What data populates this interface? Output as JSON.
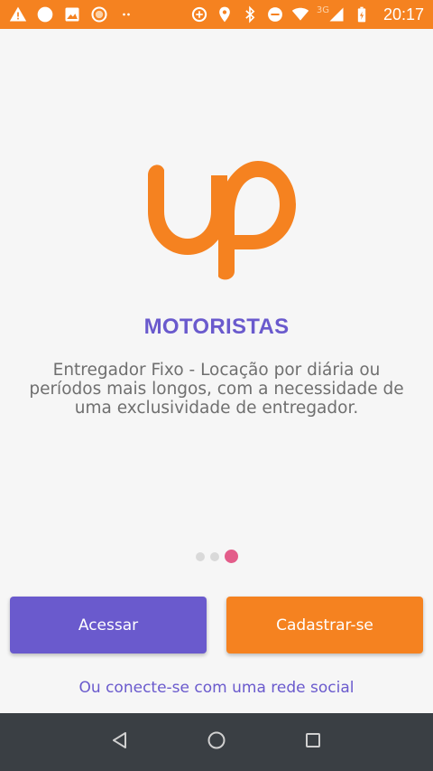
{
  "status_bar": {
    "icons_left": [
      "warning-icon",
      "circle-icon",
      "image-icon",
      "circle-outline-icon",
      "dots-icon"
    ],
    "icons_right": [
      "data-saver-icon",
      "location-icon",
      "bluetooth-icon",
      "dnd-icon",
      "wifi-icon",
      "signal-icon",
      "battery-icon"
    ],
    "network": "3G",
    "time": "20:17",
    "background": "#f58220"
  },
  "main": {
    "brand_color": "#f58220",
    "title": "MOTORISTAS",
    "description": "Entregador Fixo - Locação por diária ou períodos mais longos, com a necessidade de uma exclusividade de entregador.",
    "pagination": {
      "total": 3,
      "active_index": 2
    },
    "buttons": {
      "access_label": "Acessar",
      "signup_label": "Cadastrar-se"
    },
    "social_link": "Ou conecte-se com uma rede social",
    "accent_color": "#6a5acd"
  },
  "nav_bar": {
    "buttons": [
      "back-icon",
      "home-icon",
      "recents-icon"
    ]
  }
}
